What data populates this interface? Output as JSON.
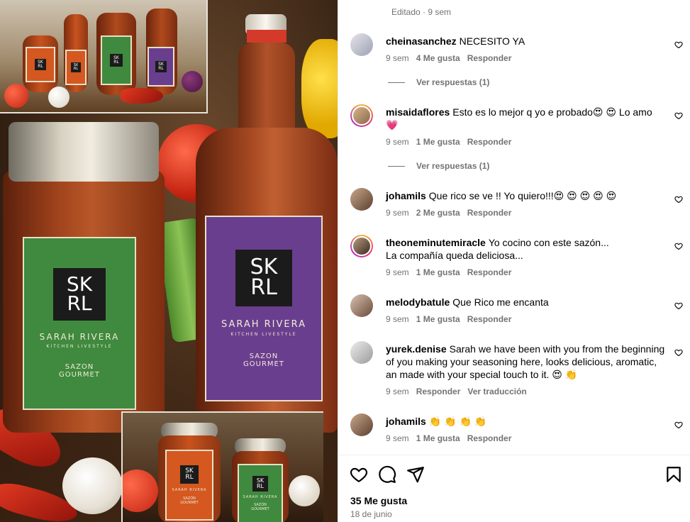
{
  "media": {
    "brand_logo_top": "SK",
    "brand_logo_bottom": "RL",
    "brand_name": "SARAH RIVERA",
    "brand_tagline": "KITCHEN LIVESTYLE",
    "product_line1": "SAZON",
    "product_line2": "GOURMET",
    "product_line1_accent": "SAZÓN"
  },
  "post": {
    "edited_text": "Editado · 9 sem",
    "likes_text": "35 Me gusta",
    "date_text": "18 de junio"
  },
  "comments": [
    {
      "user": "cheinasanchez",
      "text": "NECESITO YA",
      "time": "9 sem",
      "likes": "4 Me gusta",
      "reply": "Responder",
      "view_replies": "Ver respuestas (1)"
    },
    {
      "user": "misaidaflores",
      "text": "Esto es lo mejor q yo e probado😍 😍 Lo amo 💗",
      "time": "9 sem",
      "likes": "1 Me gusta",
      "reply": "Responder",
      "view_replies": "Ver respuestas (1)"
    },
    {
      "user": "johamils",
      "text": "Que rico se ve !! Yo quiero!!!😍 😍 😍 😍 😍",
      "time": "9 sem",
      "likes": "2 Me gusta",
      "reply": "Responder"
    },
    {
      "user": "theoneminutemiracle",
      "text": "Yo cocino con este sazón...",
      "text2": "La compañía queda deliciosa...",
      "time": "9 sem",
      "likes": "1 Me gusta",
      "reply": "Responder"
    },
    {
      "user": "melodybatule",
      "text": "Que Rico me encanta",
      "time": "9 sem",
      "likes": "1 Me gusta",
      "reply": "Responder"
    },
    {
      "user": "yurek.denise",
      "text": "Sarah we have been with you from the beginning of you making your seasoning here, looks delicious, aromatic, an made with your special touch to it. 😍 👏",
      "time": "9 sem",
      "reply": "Responder",
      "translate": "Ver traducción"
    },
    {
      "user": "johamils",
      "text": "👏 👏 👏 👏",
      "time": "9 sem",
      "likes": "1 Me gusta",
      "reply": "Responder"
    }
  ],
  "colors": {
    "muted": "#737373",
    "text": "#000000",
    "divider": "#efefef",
    "green_label": "#3f8a3e",
    "purple_label": "#6a3e8e",
    "orange_label": "#d4581f"
  }
}
